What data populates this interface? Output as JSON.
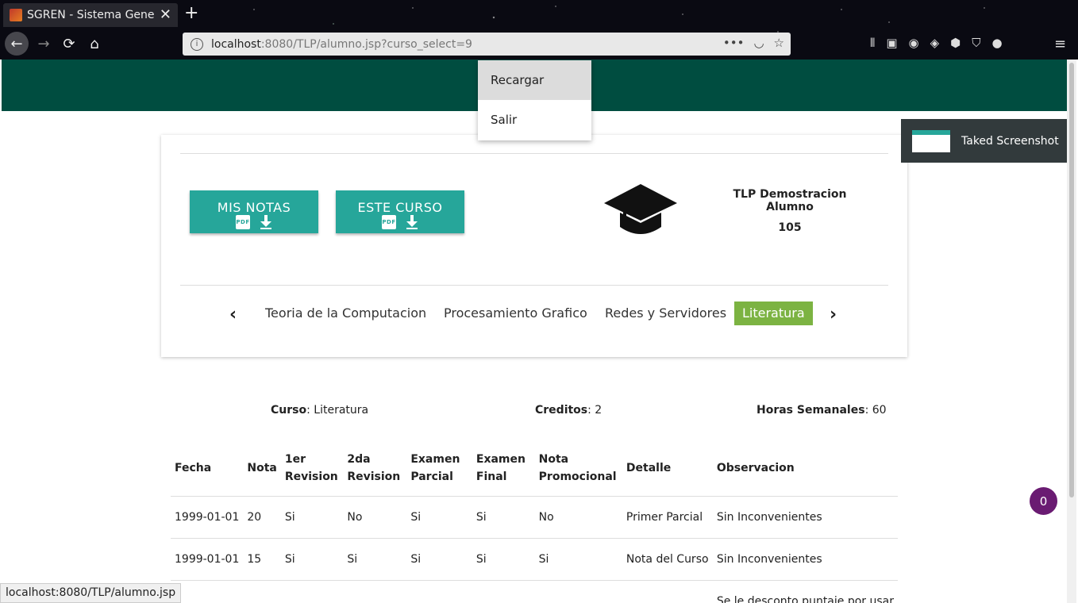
{
  "browser": {
    "tab_title": "SGREN - Sistema General",
    "url_host": "localhost",
    "url_rest": ":8080/TLP/alumno.jsp?curso_select=9",
    "status_url": "localhost:8080/TLP/alumno.jsp",
    "new_tab": "+",
    "close": "✕",
    "badge_count": "0"
  },
  "menu": {
    "items": [
      "Recargar",
      "Salir"
    ]
  },
  "buttons": {
    "mis_notas": "MIS NOTAS",
    "este_curso": "ESTE CURSO",
    "pdf": "PDF"
  },
  "student": {
    "name": "TLP Demostracion Alumno",
    "id": "105"
  },
  "courses": {
    "prev": "‹",
    "next": "›",
    "items": [
      "Teoria de la Computacion",
      "Procesamiento Grafico",
      "Redes y Servidores",
      "Literatura"
    ],
    "active": "Literatura"
  },
  "course_info": {
    "curso_label": "Curso",
    "curso_value": ": Literatura",
    "creditos_label": "Creditos",
    "creditos_value": ": 2",
    "horas_label": "Horas Semanales",
    "horas_value": ": 60"
  },
  "table": {
    "headers": [
      "Fecha",
      "Nota",
      "1er Revision",
      "2da Revision",
      "Examen Parcial",
      "Examen Final",
      "Nota Promocional",
      "Detalle",
      "Observacion"
    ],
    "rows": [
      [
        "1999-01-01",
        "20",
        "Si",
        "No",
        "Si",
        "Si",
        "No",
        "Primer Parcial",
        "Sin Inconvenientes"
      ],
      [
        "1999-01-01",
        "15",
        "Si",
        "Si",
        "Si",
        "Si",
        "Si",
        "Nota del Curso",
        "Sin Inconvenientes"
      ],
      [
        "",
        "",
        "",
        "",
        "",
        "",
        "",
        "",
        "Se le desconto puntaje por usar"
      ]
    ]
  },
  "toast": {
    "text": "Taked Screenshot"
  },
  "fab": {
    "count": "0"
  },
  "colors": {
    "topbar": "#004d40",
    "button": "#26a69a",
    "active_tab": "#7cb342",
    "fab": "#6a1b72"
  }
}
